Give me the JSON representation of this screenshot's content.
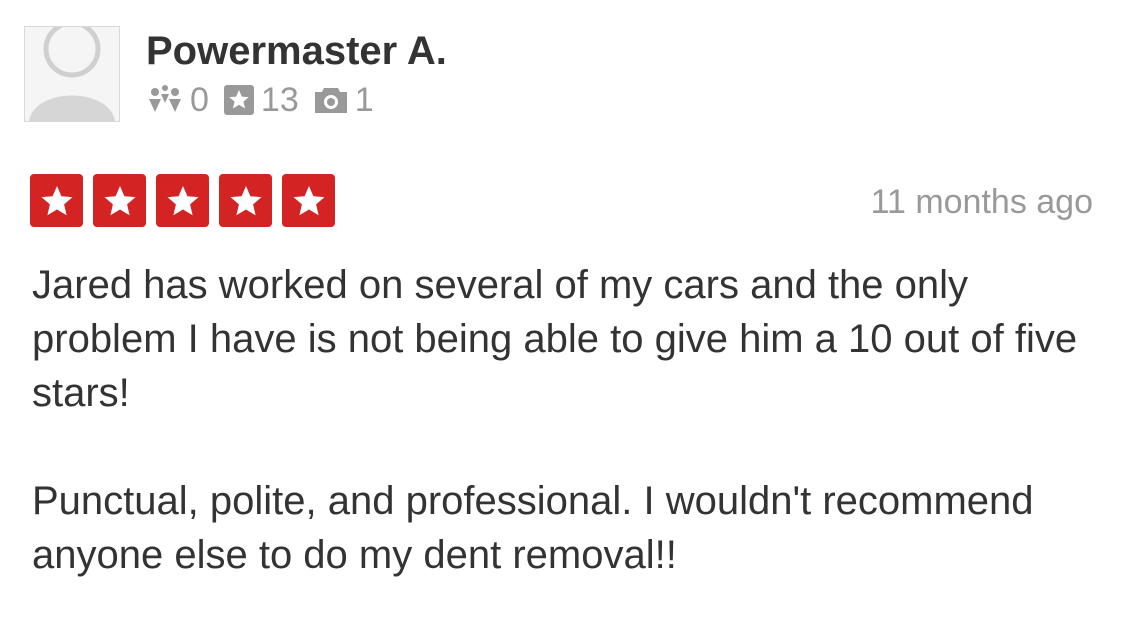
{
  "user": {
    "name": "Powermaster A.",
    "avatar_icon": "default-avatar-icon",
    "stats": {
      "friends": "0",
      "friends_icon": "friends-icon",
      "reviews": "13",
      "reviews_icon": "star-review-icon",
      "photos": "1",
      "photos_icon": "camera-icon"
    }
  },
  "review": {
    "rating": 5,
    "rating_max": 5,
    "star_color": "#d32323",
    "time_ago": "11 months ago",
    "paragraphs": [
      "Jared has worked on several of my cars and the only problem I have is not being able to give him a 10 out of five stars!",
      "Punctual, polite, and professional. I wouldn't recommend anyone else to do my dent removal!!"
    ]
  }
}
